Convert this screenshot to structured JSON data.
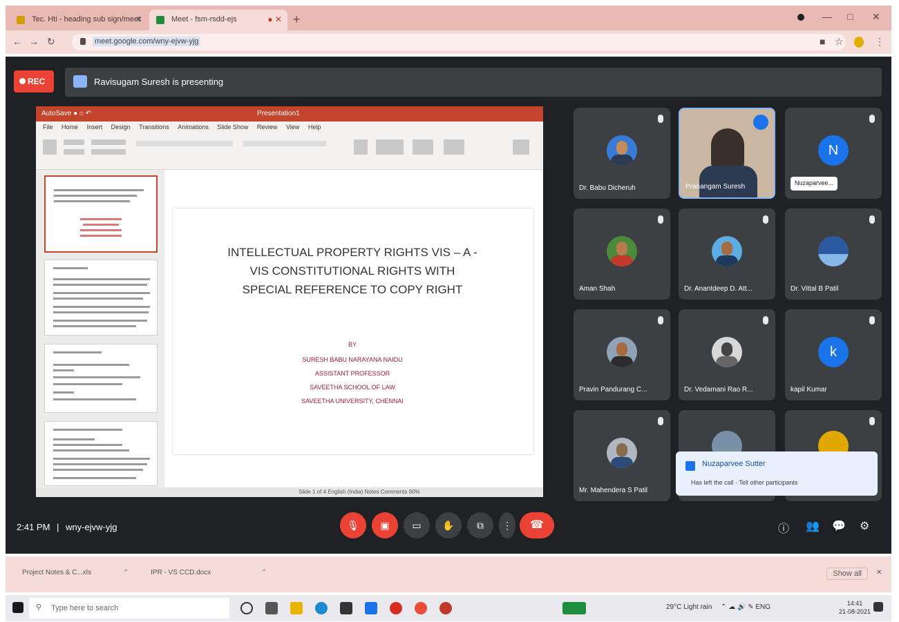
{
  "browser": {
    "tabs": [
      {
        "title": "Tec. Hti - heading sub sign/meet"
      },
      {
        "title": "Meet - fsm-rsdd-ejs"
      }
    ],
    "new_tab": "+",
    "url": "meet.google.com/wny-ejvw-yjg",
    "window": {
      "minimize": "—",
      "maximize": "□",
      "close": "✕"
    }
  },
  "meet": {
    "rec_label": "REC",
    "presenting_text": "Ravisugam Suresh is presenting",
    "clock": "2:41 PM",
    "meeting_code": "wny-ejvw-yjg",
    "participants": [
      {
        "name": "Dr. Babu Dicheruh",
        "avatar": "photo"
      },
      {
        "name": "Pranangam Suresh",
        "avatar": "video"
      },
      {
        "name": "Nuzaparvee...",
        "avatar": "N",
        "color": "#1a73e8",
        "chip": true
      },
      {
        "name": "Aman Shah",
        "avatar": "photo"
      },
      {
        "name": "Dr. Anantdeep D. Att...",
        "avatar": "photo"
      },
      {
        "name": "Dr. Vittal B Patil",
        "avatar": "photo"
      },
      {
        "name": "Pravin Pandurang C...",
        "avatar": "photo"
      },
      {
        "name": "Dr. Vedamani Rao R...",
        "avatar": "photo"
      },
      {
        "name": "kapil Kumar",
        "avatar": "k",
        "color": "#1a73e8"
      },
      {
        "name": "Mr. Mahendera S Patil",
        "avatar": "photo"
      },
      {
        "name": "",
        "avatar": "photo"
      },
      {
        "name": "",
        "avatar": "photo"
      }
    ],
    "toast": {
      "title": "Nuzaparvee Sutter",
      "message": "Has left the call · Tell other participants"
    }
  },
  "powerpoint": {
    "titlebar_left": "AutoSave  ●  ⌂  ↶",
    "titlebar_center": "Presentation1",
    "menu": [
      "File",
      "Home",
      "Insert",
      "Design",
      "Transitions",
      "Animations",
      "Slide Show",
      "Review",
      "View",
      "Help"
    ],
    "slide": {
      "title_lines": [
        "INTELLECTUAL PROPERTY RIGHTS VIS – A -",
        "VIS CONSTITUTIONAL RIGHTS WITH",
        "SPECIAL REFERENCE TO COPY RIGHT"
      ],
      "by": "BY",
      "author": "SURESH BABU NARAYANA NAIDU",
      "role": "ASSISTANT PROFESSOR",
      "school": "SAVEETHA SCHOOL OF LAW",
      "university": "SAVEETHA UNIVERSITY, CHENNAI"
    },
    "status": "Slide 1 of 4   English (India)        Notes   Comments        90%"
  },
  "shelf": {
    "items": [
      "Project Notes & C...xls",
      "IPR - VS CCD.docx"
    ],
    "show_all": "Show all"
  },
  "taskbar": {
    "search_placeholder": "Type here to search",
    "weather": "29°C Light rain",
    "time": "14:41",
    "date": "21-08-2021"
  }
}
